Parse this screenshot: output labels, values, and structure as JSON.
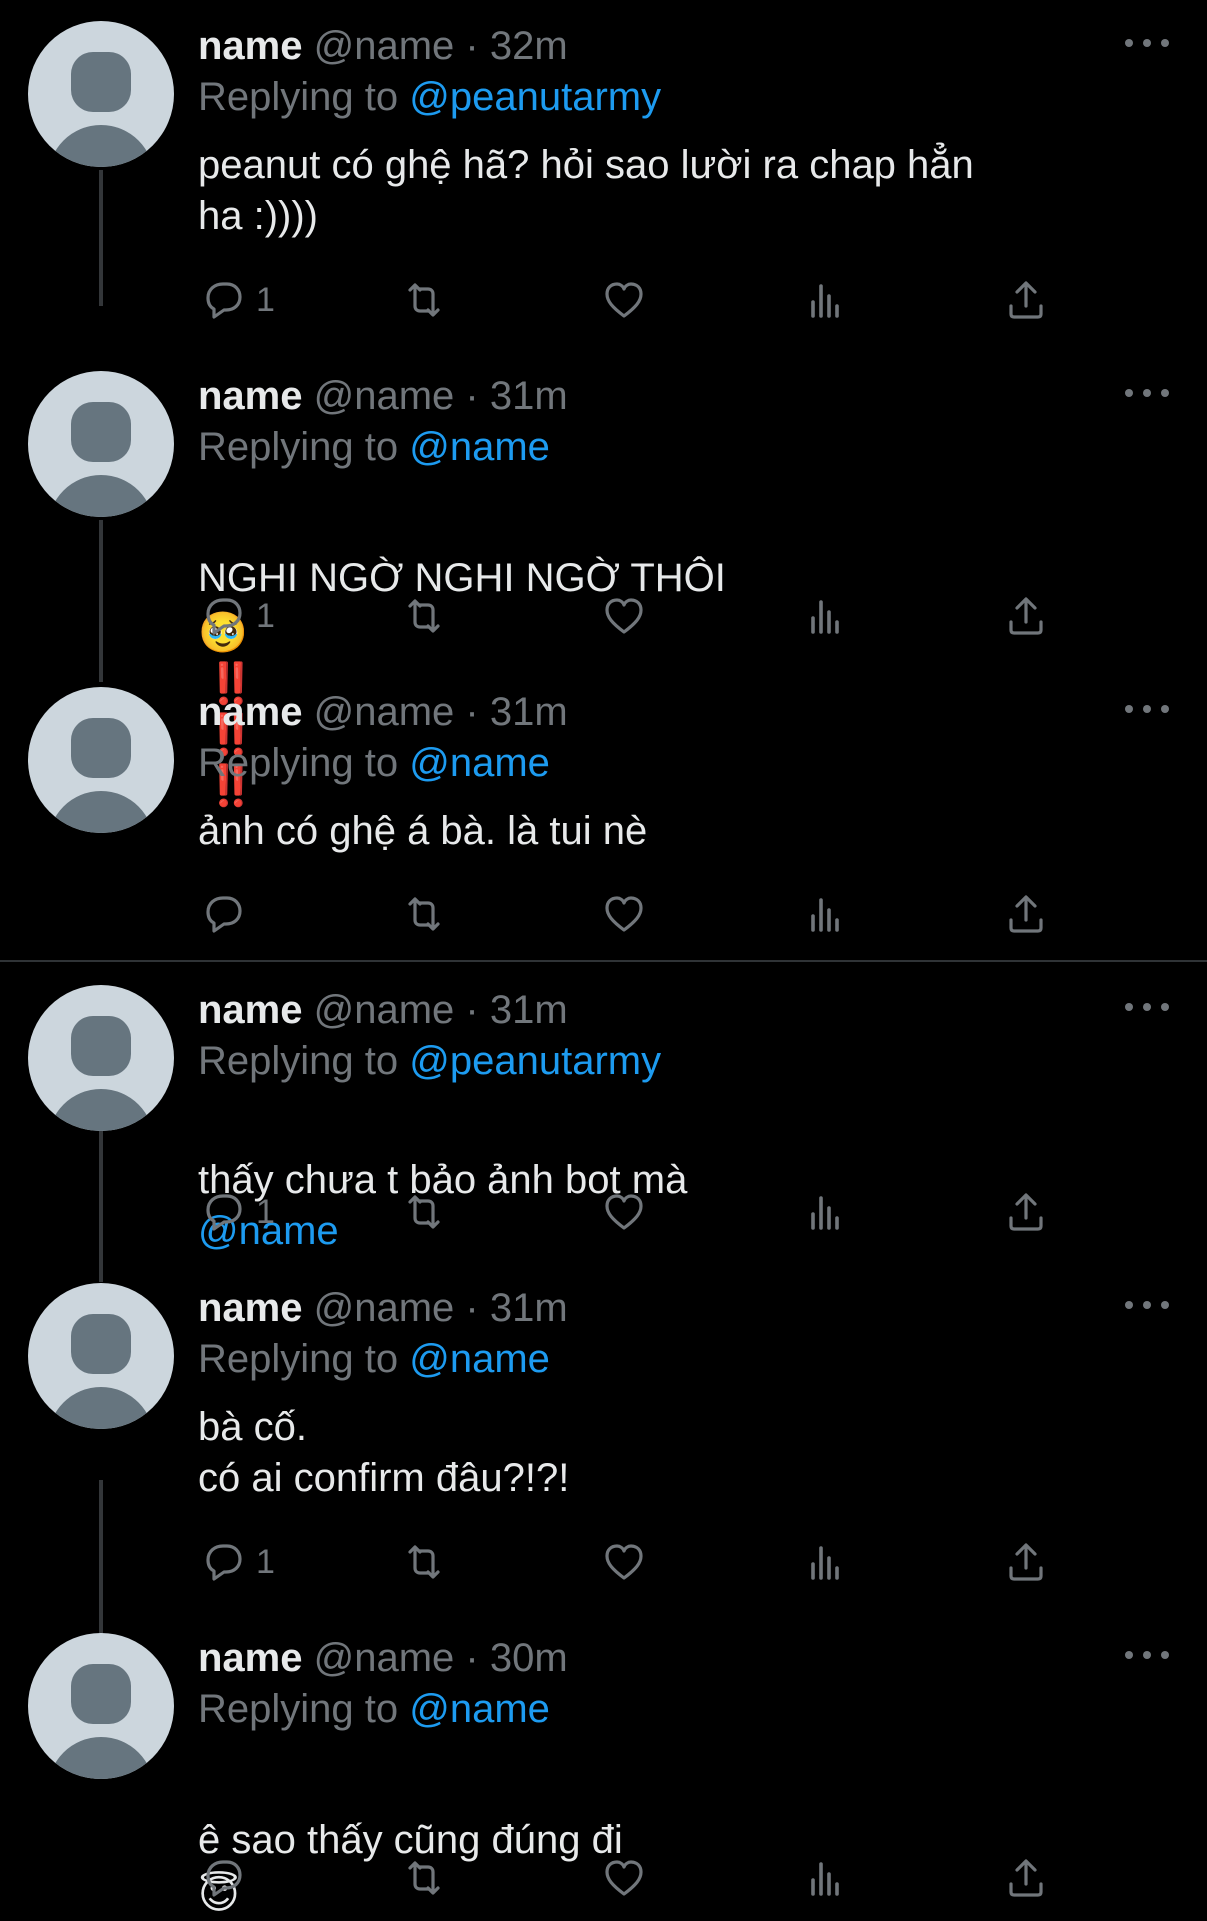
{
  "colors": {
    "background": "#000000",
    "text": "#e7e9ea",
    "muted": "#71767b",
    "accent": "#1d9bf0",
    "avatar_bg": "#ccd6dd",
    "avatar_fg": "#66757f",
    "alert_red": "#e0141e"
  },
  "icons": {
    "reply": "reply-icon",
    "retweet": "retweet-icon",
    "like": "heart-icon",
    "views": "analytics-icon",
    "share": "share-icon",
    "more": "more-options-icon",
    "avatar": "default-avatar-icon"
  },
  "tweets": [
    {
      "name": "name",
      "handle": "@name",
      "separator": "·",
      "time": "32m",
      "replying_prefix": "Replying to",
      "replying_to": "@peanutarmy",
      "text": "peanut có ghệ hã? hỏi sao lười ra chap hẳn\nha :))))",
      "reply_count": "1"
    },
    {
      "name": "name",
      "handle": "@name",
      "separator": "·",
      "time": "31m",
      "replying_prefix": "Replying to",
      "replying_to": "@name",
      "text": "NGHI NGỜ NGHI NGỜ THÔI",
      "emoji": "🥹",
      "exclaims": [
        "‼️",
        "‼️",
        "‼️"
      ],
      "reply_count": "1"
    },
    {
      "name": "name",
      "handle": "@name",
      "separator": "·",
      "time": "31m",
      "replying_prefix": "Replying to",
      "replying_to": "@name",
      "text": "ảnh có ghệ á bà. là tui nè",
      "reply_count": ""
    },
    {
      "name": "name",
      "handle": "@name",
      "separator": "·",
      "time": "31m",
      "replying_prefix": "Replying to",
      "replying_to": "@peanutarmy",
      "text": "thấy chưa t bảo ảnh bot mà",
      "text_mention": "@name",
      "reply_count": "1"
    },
    {
      "name": "name",
      "handle": "@name",
      "separator": "·",
      "time": "31m",
      "replying_prefix": "Replying to",
      "replying_to": "@name",
      "text": "bà cố.\ncó ai confirm đâu?!?!",
      "reply_count": "1"
    },
    {
      "name": "name",
      "handle": "@name",
      "separator": "·",
      "time": "30m",
      "replying_prefix": "Replying to",
      "replying_to": "@name",
      "text": "ê sao thấy cũng đúng đi",
      "emoji": "😇",
      "reply_count": ""
    }
  ]
}
